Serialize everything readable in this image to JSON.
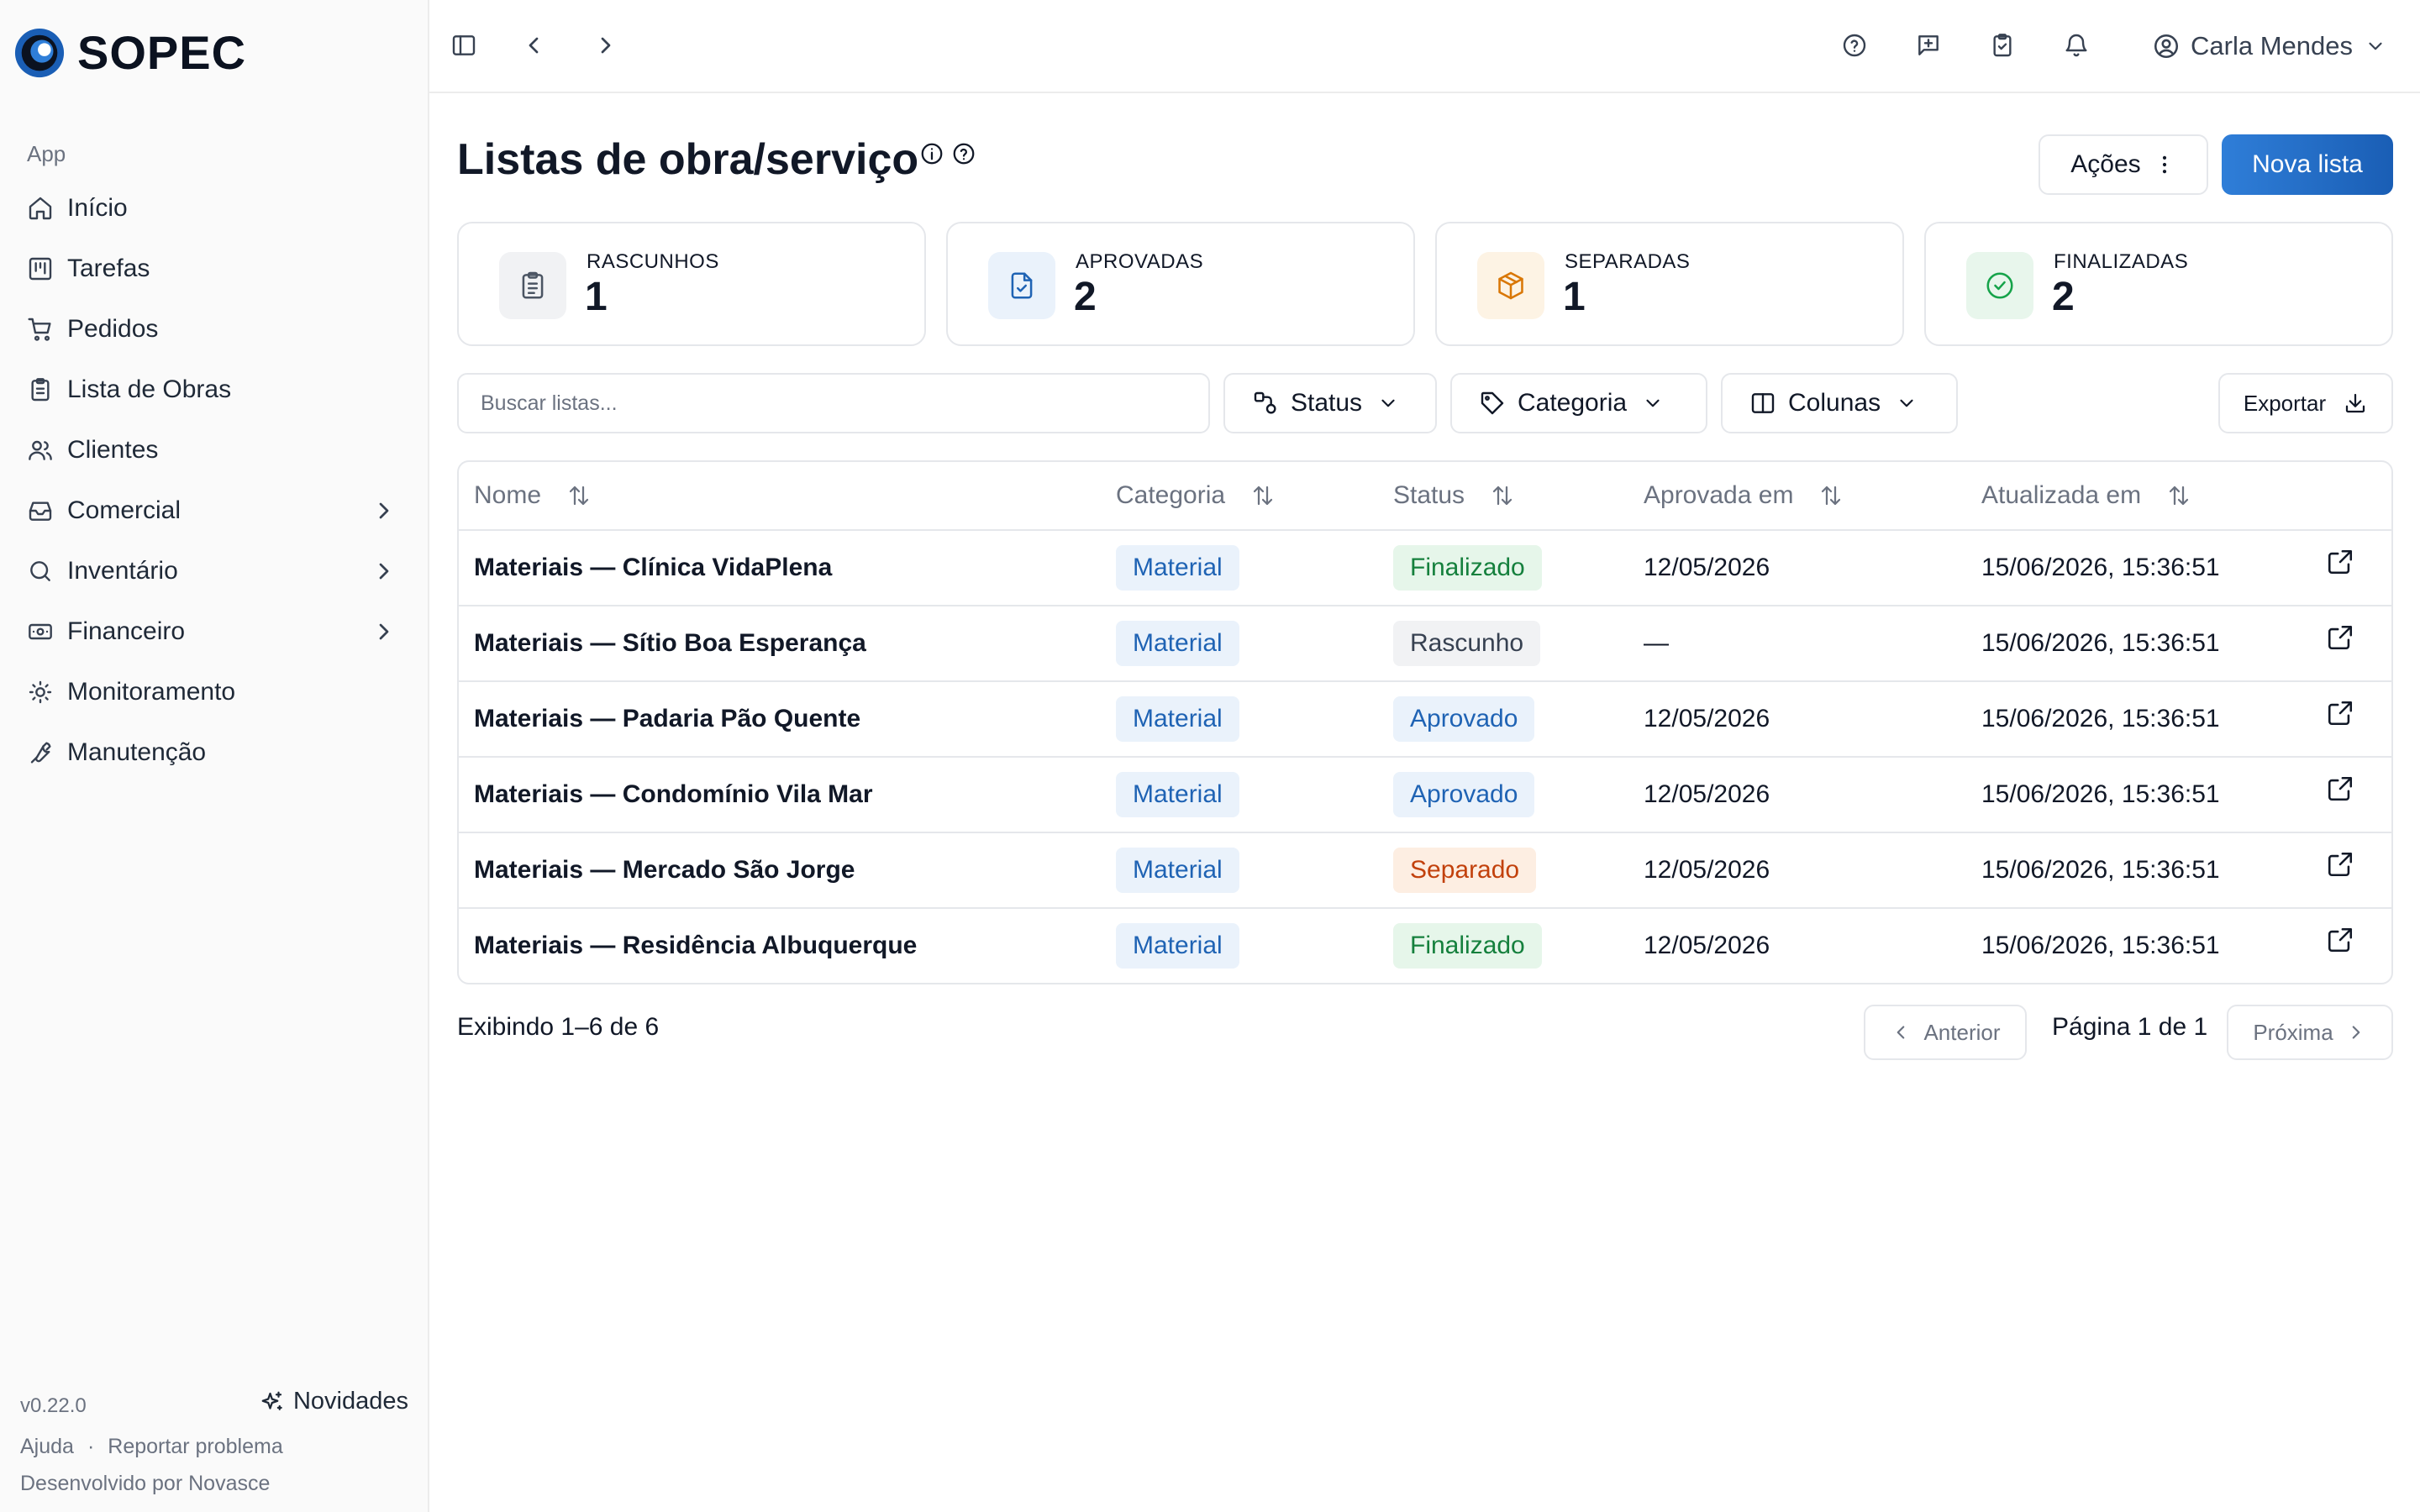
{
  "app": {
    "brand": "SOPEC",
    "accent": "#1a5eb5"
  },
  "sidebar": {
    "section": "App",
    "items": [
      {
        "label": "Início",
        "icon": "home-icon"
      },
      {
        "label": "Tarefas",
        "icon": "kanban-icon"
      },
      {
        "label": "Pedidos",
        "icon": "cart-icon"
      },
      {
        "label": "Lista de Obras",
        "icon": "clipboard-icon"
      },
      {
        "label": "Clientes",
        "icon": "users-icon"
      },
      {
        "label": "Comercial",
        "icon": "inbox-icon",
        "expandable": true
      },
      {
        "label": "Inventário",
        "icon": "search-icon",
        "expandable": true
      },
      {
        "label": "Financeiro",
        "icon": "banknote-icon",
        "expandable": true
      },
      {
        "label": "Monitoramento",
        "icon": "sun-icon"
      },
      {
        "label": "Manutenção",
        "icon": "wrench-icon"
      }
    ],
    "footer": {
      "version": "v0.22.0",
      "novidades": "Novidades",
      "help": "Ajuda",
      "separator": "·",
      "report": "Reportar problema",
      "developed_by": "Desenvolvido por Novasce"
    }
  },
  "topbar": {
    "user_name": "Carla Mendes"
  },
  "page": {
    "title": "Listas de obra/serviço",
    "actions_label": "Ações",
    "new_label": "Nova lista"
  },
  "stats": [
    {
      "label": "RASCUNHOS",
      "value": "1",
      "icon": "clipboard-list-icon",
      "color": "#4b5563",
      "bg": "#f1f2f4"
    },
    {
      "label": "APROVADAS",
      "value": "2",
      "icon": "file-check-icon",
      "color": "#1f63b4",
      "bg": "#eaf2fb"
    },
    {
      "label": "SEPARADAS",
      "value": "1",
      "icon": "package-icon",
      "color": "#d97706",
      "bg": "#fdf3e4"
    },
    {
      "label": "FINALIZADAS",
      "value": "2",
      "icon": "check-circle-icon",
      "color": "#16a34a",
      "bg": "#e8f6ec"
    }
  ],
  "filters": {
    "search_placeholder": "Buscar listas...",
    "status": "Status",
    "categoria": "Categoria",
    "colunas": "Colunas",
    "export": "Exportar"
  },
  "table": {
    "columns": [
      "Nome",
      "Categoria",
      "Status",
      "Aprovada em",
      "Atualizada em"
    ],
    "status_colors": {
      "Finalizado": {
        "bg": "#e6f6ea",
        "fg": "#15803d"
      },
      "Rascunho": {
        "bg": "#f1f2f4",
        "fg": "#374151"
      },
      "Aprovado": {
        "bg": "#eaf2fb",
        "fg": "#1f63b4"
      },
      "Separado": {
        "bg": "#fdeee2",
        "fg": "#c2410c"
      }
    },
    "rows": [
      {
        "nome": "Materiais — Clínica VidaPlena",
        "categoria": "Material",
        "status": "Finalizado",
        "aprovada": "12/05/2026",
        "atualizada": "15/06/2026, 15:36:51"
      },
      {
        "nome": "Materiais — Sítio Boa Esperança",
        "categoria": "Material",
        "status": "Rascunho",
        "aprovada": "—",
        "atualizada": "15/06/2026, 15:36:51"
      },
      {
        "nome": "Materiais — Padaria Pão Quente",
        "categoria": "Material",
        "status": "Aprovado",
        "aprovada": "12/05/2026",
        "atualizada": "15/06/2026, 15:36:51"
      },
      {
        "nome": "Materiais — Condomínio Vila Mar",
        "categoria": "Material",
        "status": "Aprovado",
        "aprovada": "12/05/2026",
        "atualizada": "15/06/2026, 15:36:51"
      },
      {
        "nome": "Materiais — Mercado São Jorge",
        "categoria": "Material",
        "status": "Separado",
        "aprovada": "12/05/2026",
        "atualizada": "15/06/2026, 15:36:51"
      },
      {
        "nome": "Materiais — Residência Albuquerque",
        "categoria": "Material",
        "status": "Finalizado",
        "aprovada": "12/05/2026",
        "atualizada": "15/06/2026, 15:36:51"
      }
    ]
  },
  "pagination": {
    "showing": "Exibindo 1–6 de 6",
    "prev": "Anterior",
    "page_info": "Página 1 de 1",
    "next": "Próxima"
  }
}
